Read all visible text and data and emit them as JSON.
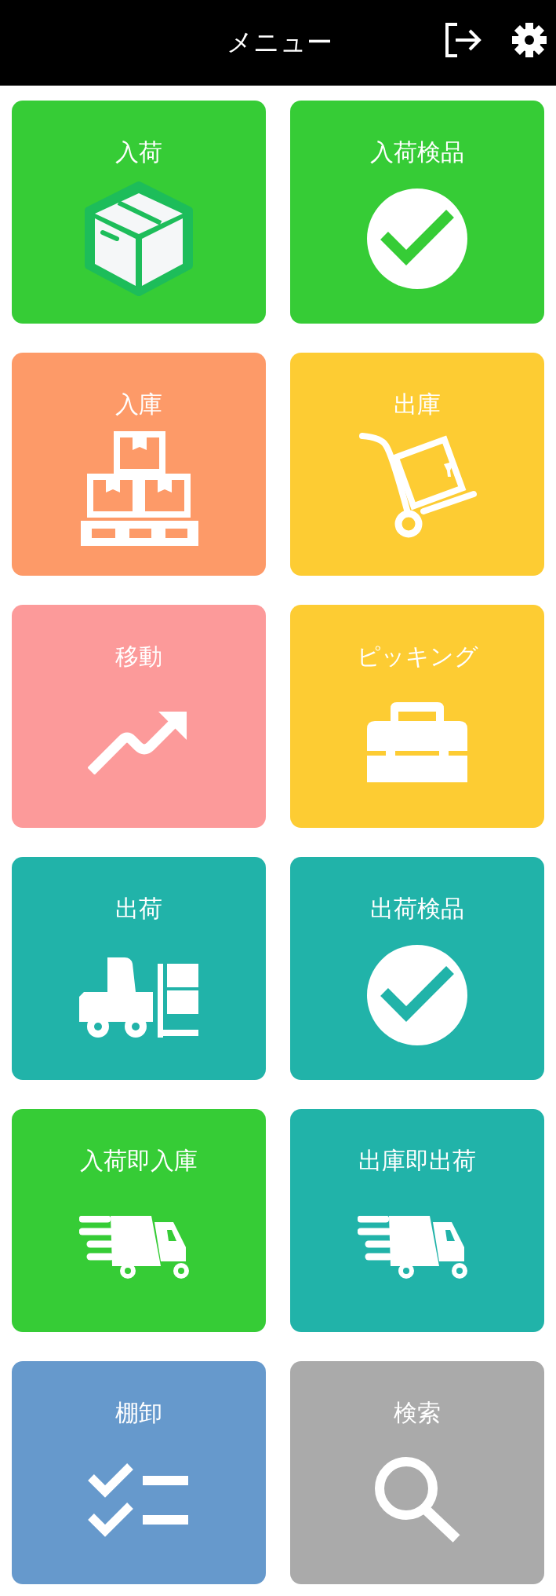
{
  "header": {
    "title": "メニュー"
  },
  "tiles": [
    {
      "label": "入荷",
      "kind": "box",
      "color": "#36cc36"
    },
    {
      "label": "入荷検品",
      "kind": "check",
      "color": "#36cc36"
    },
    {
      "label": "入庫",
      "kind": "pallet",
      "color": "#fd9a68"
    },
    {
      "label": "出庫",
      "kind": "cart",
      "color": "#fdcc33"
    },
    {
      "label": "移動",
      "kind": "trend",
      "color": "#fc9a9a"
    },
    {
      "label": "ピッキング",
      "kind": "toolbox",
      "color": "#fdcc33"
    },
    {
      "label": "出荷",
      "kind": "forklift",
      "color": "#21b3a9"
    },
    {
      "label": "出荷検品",
      "kind": "check",
      "color": "#21b3a9"
    },
    {
      "label": "入荷即入庫",
      "kind": "truck",
      "color": "#36cc36"
    },
    {
      "label": "出庫即出荷",
      "kind": "truck",
      "color": "#21b3a9"
    },
    {
      "label": "棚卸",
      "kind": "checklist",
      "color": "#6699cc"
    },
    {
      "label": "検索",
      "kind": "search",
      "color": "#aaaaaa"
    }
  ]
}
